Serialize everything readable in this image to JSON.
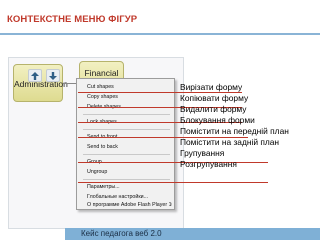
{
  "slide": {
    "title": "КОНТЕКСТНЕ МЕНЮ ФІГУР",
    "footer": "Кейс педагога веб 2.0",
    "accent_title": "#c0392b",
    "accent_rule": "#8ab4d6",
    "footer_color": "#7fb0d6"
  },
  "diagram": {
    "nodes": [
      {
        "label": "Administration"
      },
      {
        "label": "Financial"
      }
    ],
    "toolbar": [
      {
        "icon": "arrow-up-icon"
      },
      {
        "icon": "arrow-down-icon"
      }
    ]
  },
  "context_menu": {
    "items": [
      {
        "label": "Cut shapes"
      },
      {
        "label": "Copy shapes"
      },
      {
        "label": "Delete shapes"
      },
      {
        "label": "Lock shapes"
      },
      {
        "label": "Send to front"
      },
      {
        "label": "Send to back"
      },
      {
        "label": "Group"
      },
      {
        "label": "Ungroup"
      },
      {
        "label": "Параметры..."
      },
      {
        "label": "Глобальные настройки..."
      },
      {
        "label": "О программе Adobe Flash Player 10..."
      }
    ]
  },
  "callouts": [
    {
      "text": "Вирізати форму"
    },
    {
      "text": "Копіювати форму"
    },
    {
      "text": "Видалити форму"
    },
    {
      "text": "Блокування форми"
    },
    {
      "text": "Помістити на передній план"
    },
    {
      "text": "Помістити на задній план"
    },
    {
      "text": "Групування"
    },
    {
      "text": "Розгрупування"
    }
  ]
}
